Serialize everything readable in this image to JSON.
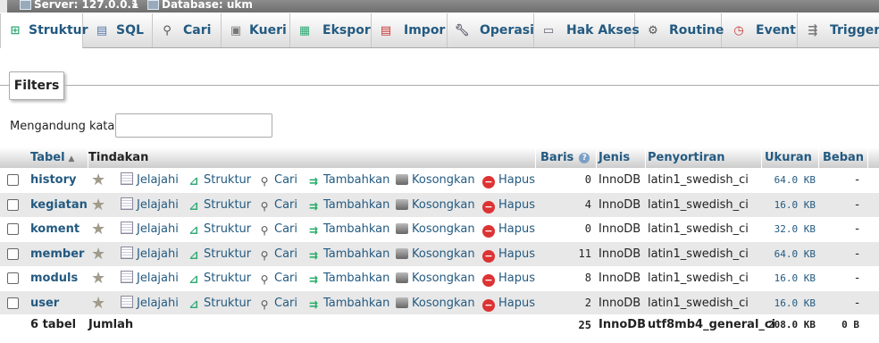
{
  "breadcrumb": {
    "server": "Server: 127.0.0.1",
    "separator": "»",
    "database": "Database: ukm"
  },
  "tabs": [
    {
      "label": "Struktur",
      "icon": "structure-icon",
      "active": true
    },
    {
      "label": "SQL",
      "icon": "sql-icon"
    },
    {
      "label": "Cari",
      "icon": "search-icon"
    },
    {
      "label": "Kueri",
      "icon": "query-icon"
    },
    {
      "label": "Ekspor",
      "icon": "export-icon"
    },
    {
      "label": "Impor",
      "icon": "import-icon"
    },
    {
      "label": "Operasi",
      "icon": "wrench-icon"
    },
    {
      "label": "Hak Akses",
      "icon": "privileges-icon"
    },
    {
      "label": "Routine",
      "icon": "routine-icon"
    },
    {
      "label": "Event",
      "icon": "clock-icon"
    },
    {
      "label": "Trigger",
      "icon": "trigger-icon"
    }
  ],
  "filters": {
    "legend": "Filters",
    "label": "Mengandung kata:",
    "value": ""
  },
  "table": {
    "headers": {
      "table": "Tabel",
      "action": "Tindakan",
      "rows": "Baris",
      "type": "Jenis",
      "collation": "Penyortiran",
      "size": "Ukuran",
      "overhead": "Beban"
    },
    "actions": {
      "browse": "Jelajahi",
      "structure": "Struktur",
      "search": "Cari",
      "insert": "Tambahkan",
      "empty": "Kosongkan",
      "drop": "Hapus"
    },
    "rows": [
      {
        "name": "history",
        "rows": "0",
        "type": "InnoDB",
        "collation": "latin1_swedish_ci",
        "size": "64.0 KB",
        "overhead": "-"
      },
      {
        "name": "kegiatan",
        "rows": "4",
        "type": "InnoDB",
        "collation": "latin1_swedish_ci",
        "size": "16.0 KB",
        "overhead": "-"
      },
      {
        "name": "koment",
        "rows": "0",
        "type": "InnoDB",
        "collation": "latin1_swedish_ci",
        "size": "32.0 KB",
        "overhead": "-"
      },
      {
        "name": "member",
        "rows": "11",
        "type": "InnoDB",
        "collation": "latin1_swedish_ci",
        "size": "64.0 KB",
        "overhead": "-"
      },
      {
        "name": "moduls",
        "rows": "8",
        "type": "InnoDB",
        "collation": "latin1_swedish_ci",
        "size": "16.0 KB",
        "overhead": "-"
      },
      {
        "name": "user",
        "rows": "2",
        "type": "InnoDB",
        "collation": "latin1_swedish_ci",
        "size": "16.0 KB",
        "overhead": "-"
      }
    ],
    "footer": {
      "count": "6 tabel",
      "label": "Jumlah",
      "rows": "25",
      "type": "InnoDB",
      "collation": "utf8mb4_general_ci",
      "size": "208.0 KB",
      "overhead": "0 B"
    }
  }
}
